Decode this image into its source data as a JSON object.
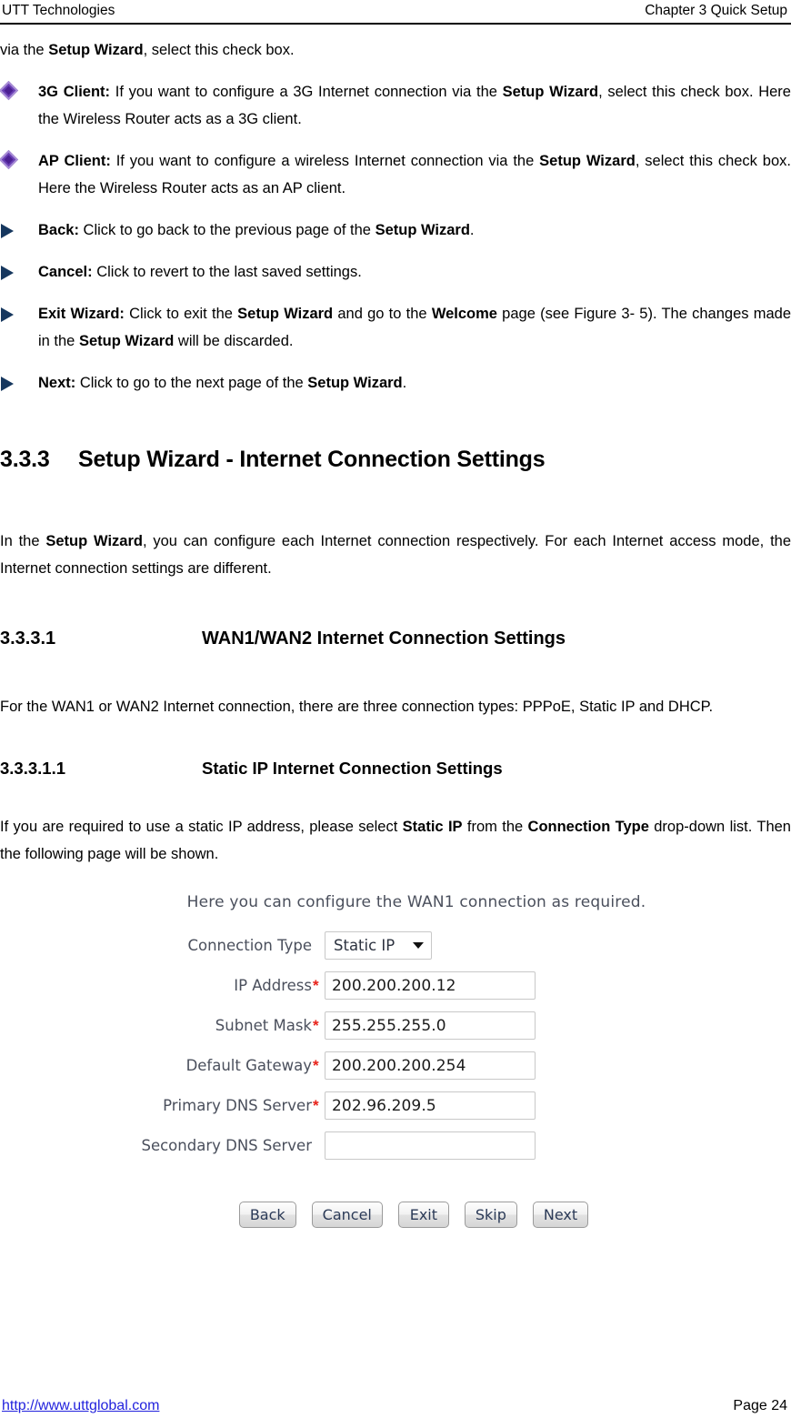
{
  "header": {
    "left": "UTT Technologies",
    "right": "Chapter 3 Quick Setup"
  },
  "intro_continuation": {
    "lead": "via the ",
    "bold": "Setup Wizard",
    "tail": ", select this check box."
  },
  "bullets": [
    {
      "icon": "purple-diamond-icon",
      "term": "3G Client:",
      "segments": [
        {
          "text": " If you want to configure a 3G Internet connection via the ",
          "bold": false
        },
        {
          "text": "Setup Wizard",
          "bold": true
        },
        {
          "text": ", select this check box. Here the Wireless Router acts as a 3G client.",
          "bold": false
        }
      ]
    },
    {
      "icon": "purple-diamond-icon",
      "term": "AP Client:",
      "segments": [
        {
          "text": " If you want to configure a wireless Internet connection via the ",
          "bold": false
        },
        {
          "text": "Setup Wizard",
          "bold": true
        },
        {
          "text": ", select this check box. Here the Wireless Router acts as an AP client.",
          "bold": false
        }
      ]
    },
    {
      "icon": "blue-arrow-icon",
      "term": "Back:",
      "segments": [
        {
          "text": " Click to go back to the previous page of the ",
          "bold": false
        },
        {
          "text": "Setup Wizard",
          "bold": true
        },
        {
          "text": ".",
          "bold": false
        }
      ]
    },
    {
      "icon": "blue-arrow-icon",
      "term": "Cancel:",
      "segments": [
        {
          "text": " Click to revert to the last saved settings.",
          "bold": false
        }
      ]
    },
    {
      "icon": "blue-arrow-icon",
      "term": "Exit Wizard:",
      "segments": [
        {
          "text": " Click to exit the ",
          "bold": false
        },
        {
          "text": "Setup Wizard",
          "bold": true
        },
        {
          "text": " and go to the ",
          "bold": false
        },
        {
          "text": "Welcome",
          "bold": true
        },
        {
          "text": " page (see Figure 3- 5). The changes made in the ",
          "bold": false
        },
        {
          "text": "Setup Wizard",
          "bold": true
        },
        {
          "text": " will be discarded.",
          "bold": false
        }
      ]
    },
    {
      "icon": "blue-arrow-icon",
      "term": "Next:",
      "segments": [
        {
          "text": " Click to go to the next page of the ",
          "bold": false
        },
        {
          "text": "Setup Wizard",
          "bold": true
        },
        {
          "text": ".",
          "bold": false
        }
      ]
    }
  ],
  "section_333": {
    "number": "3.3.3",
    "title": "Setup Wizard - Internet Connection Settings",
    "paragraph": [
      {
        "text": "In the ",
        "bold": false
      },
      {
        "text": "Setup Wizard",
        "bold": true
      },
      {
        "text": ", you can configure each Internet connection respectively. For each Internet access mode, the Internet connection settings are different.",
        "bold": false
      }
    ]
  },
  "section_3331": {
    "number": "3.3.3.1",
    "title": "WAN1/WAN2 Internet Connection Settings",
    "paragraph": [
      {
        "text": "For the WAN1 or WAN2 Internet connection, there are three connection types: PPPoE, Static IP and DHCP.",
        "bold": false
      }
    ]
  },
  "section_33311": {
    "number": "3.3.3.1.1",
    "title": "Static IP Internet Connection Settings",
    "paragraph": [
      {
        "text": "If you are required to use a static IP address, please select ",
        "bold": false
      },
      {
        "text": "Static IP",
        "bold": true
      },
      {
        "text": " from the ",
        "bold": false
      },
      {
        "text": "Connection Type",
        "bold": true
      },
      {
        "text": " drop-down list. Then the following page will be shown.",
        "bold": false
      }
    ]
  },
  "app_screenshot": {
    "caption": "Here you can configure the WAN1 connection as required.",
    "fields": [
      {
        "label": "Connection Type",
        "required": false,
        "control": "select",
        "value": "Static IP",
        "options": [
          "Static IP"
        ]
      },
      {
        "label": "IP Address",
        "required": true,
        "control": "text",
        "value": "200.200.200.12"
      },
      {
        "label": "Subnet Mask",
        "required": true,
        "control": "text",
        "value": "255.255.255.0"
      },
      {
        "label": "Default Gateway",
        "required": true,
        "control": "text",
        "value": "200.200.200.254"
      },
      {
        "label": "Primary DNS Server",
        "required": true,
        "control": "text",
        "value": "202.96.209.5"
      },
      {
        "label": "Secondary DNS Server",
        "required": false,
        "control": "text",
        "value": ""
      }
    ],
    "buttons": [
      "Back",
      "Cancel",
      "Exit",
      "Skip",
      "Next"
    ],
    "colors": {
      "label": "#4a4f5c",
      "required_star": "#e8221a",
      "field_border": "#c8c8c8",
      "button_text": "#2b3a57"
    }
  },
  "footer": {
    "url": "http://www.uttglobal.com",
    "page": "Page 24"
  }
}
